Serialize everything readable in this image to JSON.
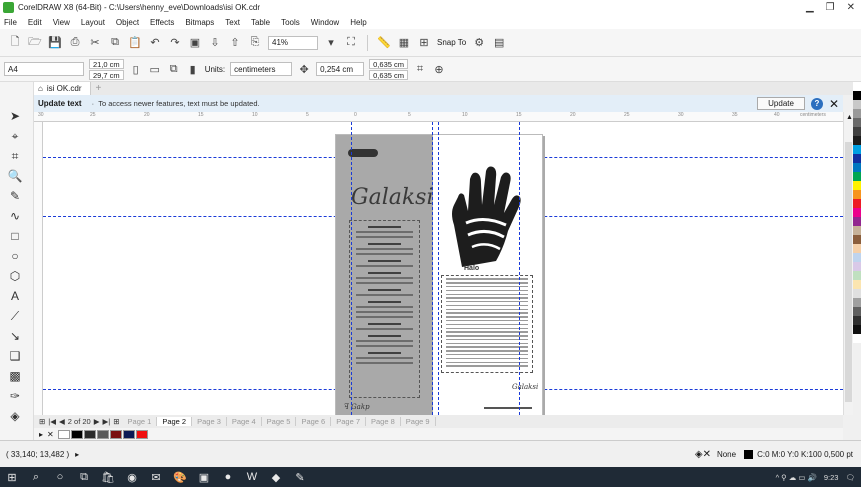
{
  "window": {
    "title": "CorelDRAW X8 (64-Bit) - C:\\Users\\henny_eve\\Downloads\\isi OK.cdr"
  },
  "menu": [
    "File",
    "Edit",
    "View",
    "Layout",
    "Object",
    "Effects",
    "Bitmaps",
    "Text",
    "Table",
    "Tools",
    "Window",
    "Help"
  ],
  "toolbar": {
    "zoom": "41%",
    "snap_to": "Snap To"
  },
  "propertybar": {
    "paper_size": "A4",
    "width": "21,0 cm",
    "height": "29,7 cm",
    "units_label": "Units:",
    "units_value": "centimeters",
    "nudge": "0,254 cm",
    "dup_x": "0,635 cm",
    "dup_y": "0,635 cm"
  },
  "document_tab": "isi OK.cdr",
  "notification": {
    "title": "Update text",
    "message": "To access newer features, text must be updated.",
    "button": "Update"
  },
  "ruler": {
    "unit": "centimeters",
    "ticks": [
      "30",
      "25",
      "20",
      "15",
      "10",
      "5",
      "0",
      "5",
      "10",
      "15",
      "20",
      "25",
      "30",
      "35",
      "40",
      "45"
    ]
  },
  "artwork": {
    "script_logo": "Galaksi",
    "right_title": "Halo",
    "small_signature": "Galaksi"
  },
  "pagenav": {
    "position": "2 of 20",
    "pages": [
      "Page 1",
      "Page 2",
      "Page 3",
      "Page 4",
      "Page 5",
      "Page 6",
      "Page 7",
      "Page 8",
      "Page 9"
    ],
    "active_index": 1
  },
  "swatches": [
    "#ffffff",
    "#000000",
    "#2b2b2b",
    "#5a5a5a",
    "#7a1010",
    "#0b1a55",
    "#f01010"
  ],
  "palette": [
    "#ffffff",
    "#000000",
    "#c8c8c8",
    "#9a9a9a",
    "#6a6a6a",
    "#404040",
    "#1c1c1c",
    "#00a0e3",
    "#1230a0",
    "#0077c0",
    "#00a651",
    "#fff200",
    "#f7941d",
    "#ed1c24",
    "#ec008c",
    "#92278f",
    "#c7b299",
    "#8b5e3c",
    "#f5d0a9",
    "#bfd4ee",
    "#d9c9e8",
    "#c0e0c0",
    "#fbe5b0",
    "#e0e0e0",
    "#a0a0a0",
    "#606060",
    "#303030",
    "#101010",
    "#ffffff"
  ],
  "status": {
    "coords": "( 33,140; 13,482 )",
    "fill": "None",
    "outline": "C:0 M:0 Y:0 K:100  0,500 pt"
  },
  "taskbar": {
    "time": "9:23"
  }
}
